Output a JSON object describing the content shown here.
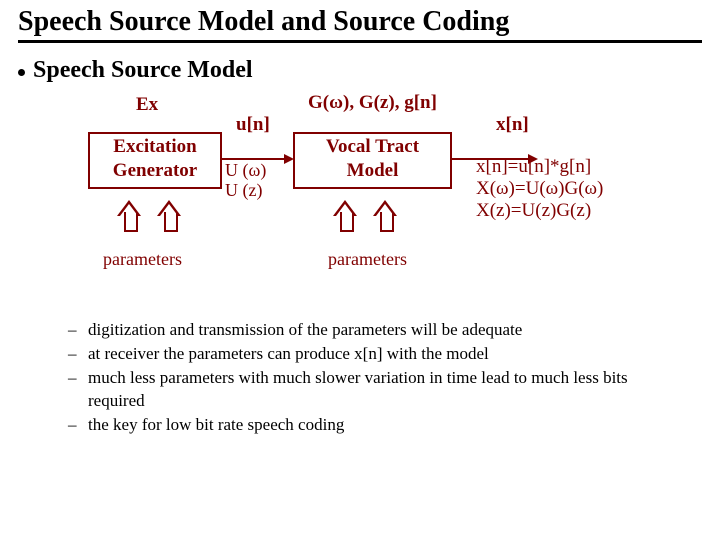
{
  "title": "Speech Source Model and Source Coding",
  "bullet": "Speech Source Model",
  "diagram": {
    "ex": "Ex",
    "excite_box_l1": "Excitation",
    "excite_box_l2": "Generator",
    "un": "u[n]",
    "uw": "U (ω)",
    "uz": "U (z)",
    "g_series": "G(ω), G(z), g[n]",
    "vocal_box_l1": "Vocal Tract",
    "vocal_box_l2": "Model",
    "xn": "x[n]",
    "eq1": "x[n]=u[n]*g[n]",
    "eq2": "X(ω)=U(ω)G(ω)",
    "eq3": "X(z)=U(z)G(z)",
    "params": "parameters"
  },
  "notes": [
    "digitization and transmission of the parameters will be adequate",
    "at receiver the parameters can produce x[n] with the model",
    "much less parameters with much slower variation in time lead to much less bits required",
    "the key for low bit rate speech coding"
  ]
}
